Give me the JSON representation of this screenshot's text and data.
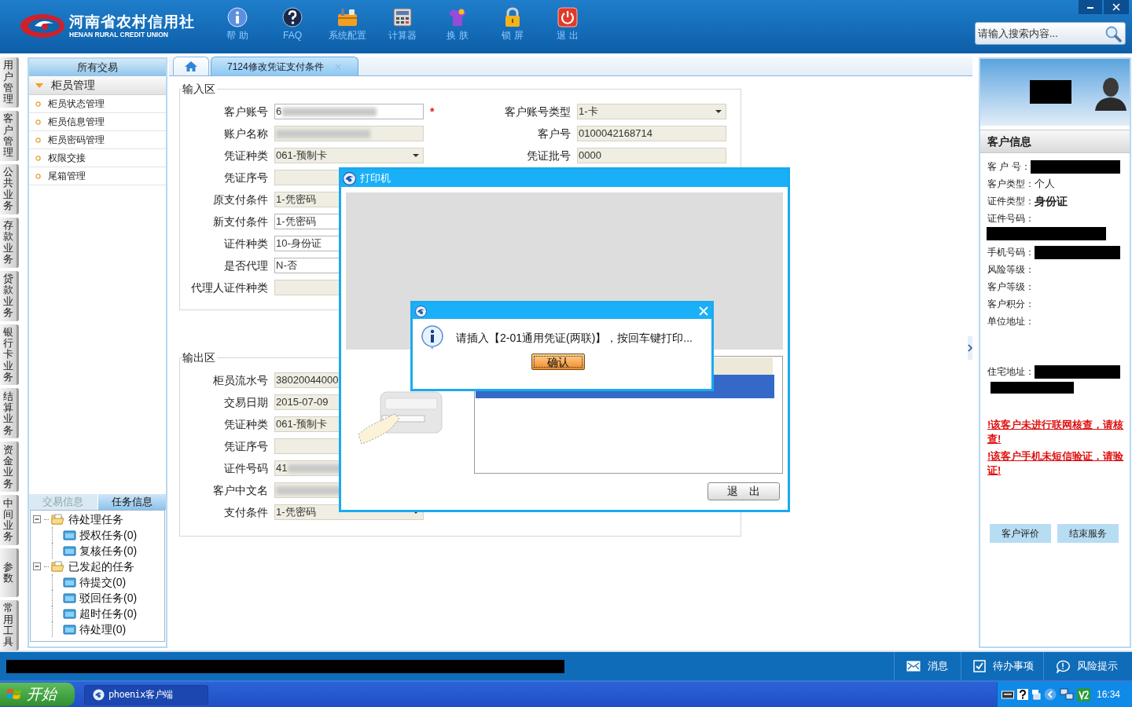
{
  "header": {
    "logo_title": "河南省农村信用社",
    "logo_subtitle": "HENAN RURAL CREDIT UNION",
    "toolbar": [
      {
        "label": "帮 助"
      },
      {
        "label": "FAQ"
      },
      {
        "label": "系统配置"
      },
      {
        "label": "计算器"
      },
      {
        "label": "换 肤"
      },
      {
        "label": "锁 屏"
      },
      {
        "label": "退 出"
      }
    ],
    "search": {
      "placeholder": "请输入搜索内容..."
    }
  },
  "side_tabs": [
    {
      "label": "用户管理"
    },
    {
      "label": "客户管理"
    },
    {
      "label": "公共业务"
    },
    {
      "label": "存款业务"
    },
    {
      "label": "贷款业务"
    },
    {
      "label": "银行卡业务"
    },
    {
      "label": "结算业务"
    },
    {
      "label": "资金业务"
    },
    {
      "label": "中间业务"
    },
    {
      "label": "参数"
    },
    {
      "label": "常用工具"
    }
  ],
  "nav": {
    "header": "所有交易",
    "group": {
      "label": "柜员管理",
      "expanded": true
    },
    "items": [
      {
        "label": "柜员状态管理"
      },
      {
        "label": "柜员信息管理"
      },
      {
        "label": "柜员密码管理"
      },
      {
        "label": "权限交接"
      },
      {
        "label": "尾箱管理"
      }
    ]
  },
  "task_panel": {
    "tabs": [
      {
        "label": "交易信息",
        "selected": false
      },
      {
        "label": "任务信息",
        "selected": true
      }
    ],
    "tree": [
      {
        "label": "待处理任务",
        "expanded": true,
        "children": [
          {
            "label": "授权任务(0)"
          },
          {
            "label": "复核任务(0)"
          }
        ]
      },
      {
        "label": "已发起的任务",
        "expanded": true,
        "children": [
          {
            "label": "待提交(0)"
          },
          {
            "label": "驳回任务(0)"
          },
          {
            "label": "超时任务(0)"
          },
          {
            "label": "待处理(0)"
          }
        ]
      }
    ]
  },
  "tabs": [
    {
      "kind": "home",
      "selected": false
    },
    {
      "kind": "page",
      "label": "7124修改凭证支付条件",
      "selected": true
    }
  ],
  "input_section": {
    "legend": "输入区",
    "rows": [
      {
        "left": {
          "label": "客户账号",
          "value": "6",
          "kind": "text",
          "editable": true,
          "blurred": true,
          "required_mark": "*"
        },
        "right": {
          "label": "客户账号类型",
          "value": "1-卡",
          "kind": "select",
          "editable": false,
          "blurred": false
        }
      },
      {
        "left": {
          "label": "账户名称",
          "kind": "text",
          "editable": false,
          "blurred": true
        },
        "right": {
          "label": "客户号",
          "value": "0100042168714",
          "kind": "text",
          "editable": false,
          "blurred": false
        }
      },
      {
        "left": {
          "label": "凭证种类",
          "value": "061-预制卡",
          "kind": "select",
          "editable": false,
          "blurred": false
        },
        "right": {
          "label": "凭证批号",
          "value": "0000",
          "kind": "text",
          "editable": false,
          "blurred": false
        }
      },
      {
        "left": {
          "label": "凭证序号",
          "kind": "text",
          "editable": false,
          "blurred": false
        }
      },
      {
        "left": {
          "label": "原支付条件",
          "value": "1-凭密码",
          "kind": "text",
          "editable": false,
          "blurred": false
        }
      },
      {
        "left": {
          "label": "新支付条件",
          "value": "1-凭密码",
          "kind": "text",
          "editable": true,
          "blurred": false
        }
      },
      {
        "left": {
          "label": "证件种类",
          "value": "10-身份证",
          "kind": "text",
          "editable": true,
          "blurred": false
        }
      },
      {
        "left": {
          "label": "是否代理",
          "value": "N-否",
          "kind": "text",
          "editable": true,
          "blurred": false
        }
      },
      {
        "left": {
          "label": "代理人证件种类",
          "kind": "text",
          "editable": false,
          "blurred": false
        }
      }
    ]
  },
  "output_section": {
    "legend": "输出区",
    "rows": [
      {
        "left": {
          "label": "柜员流水号",
          "value": "38020044000",
          "kind": "text",
          "editable": false,
          "blurred": false
        }
      },
      {
        "left": {
          "label": "交易日期",
          "value": "2015-07-09",
          "kind": "text",
          "editable": false,
          "blurred": false
        }
      },
      {
        "left": {
          "label": "凭证种类",
          "value": "061-预制卡",
          "kind": "text",
          "editable": false,
          "blurred": false
        }
      },
      {
        "left": {
          "label": "凭证序号",
          "kind": "text",
          "editable": false,
          "blurred": false
        }
      },
      {
        "left": {
          "label": "证件号码",
          "value": "41",
          "kind": "text",
          "editable": false,
          "blurred": true
        }
      },
      {
        "left": {
          "label": "客户中文名",
          "kind": "text",
          "editable": false,
          "blurred": true
        }
      },
      {
        "left": {
          "label": "支付条件",
          "value": "1-凭密码",
          "kind": "select",
          "editable": false,
          "blurred": false
        }
      }
    ]
  },
  "printer_dialog": {
    "title": "打印机",
    "list_rows": [
      {
        "selected": true
      }
    ],
    "exit_button": "退　出"
  },
  "message_dialog": {
    "message": "请插入【2-01通用凭证(两联)】，按回车键打印...",
    "confirm_button": "确认"
  },
  "customer_panel": {
    "title": "客户信息",
    "fields": [
      {
        "label": "客 户 号：",
        "kind": "redacted_inline"
      },
      {
        "label": "客户类型：",
        "value": "个人",
        "bold": false,
        "kind": "text"
      },
      {
        "label": "证件类型：",
        "value": "身份证",
        "bold": true,
        "kind": "text"
      },
      {
        "label": "证件号码：",
        "kind": "redacted_below"
      },
      {
        "label": "手机号码：",
        "kind": "redacted_inline"
      },
      {
        "label": "风险等级：",
        "kind": "text"
      },
      {
        "label": "客户等级：",
        "kind": "text"
      },
      {
        "label": "客户积分：",
        "kind": "text"
      },
      {
        "label": "单位地址：",
        "kind": "address"
      },
      {
        "label": "住宅地址：",
        "kind": "address_redacted"
      }
    ],
    "warnings": [
      "!该客户未进行联网核查，请核查!",
      "!该客户手机未短信验证，请验证!"
    ],
    "buttons": [
      "客户评价",
      "结束服务"
    ]
  },
  "status_bar": {
    "buttons": [
      {
        "label": "消息"
      },
      {
        "label": "待办事项"
      },
      {
        "label": "风险提示"
      }
    ]
  },
  "taskbar": {
    "start": "开始",
    "tasks": [
      {
        "label": "phoenix客户端"
      }
    ],
    "clock": "16:34"
  }
}
